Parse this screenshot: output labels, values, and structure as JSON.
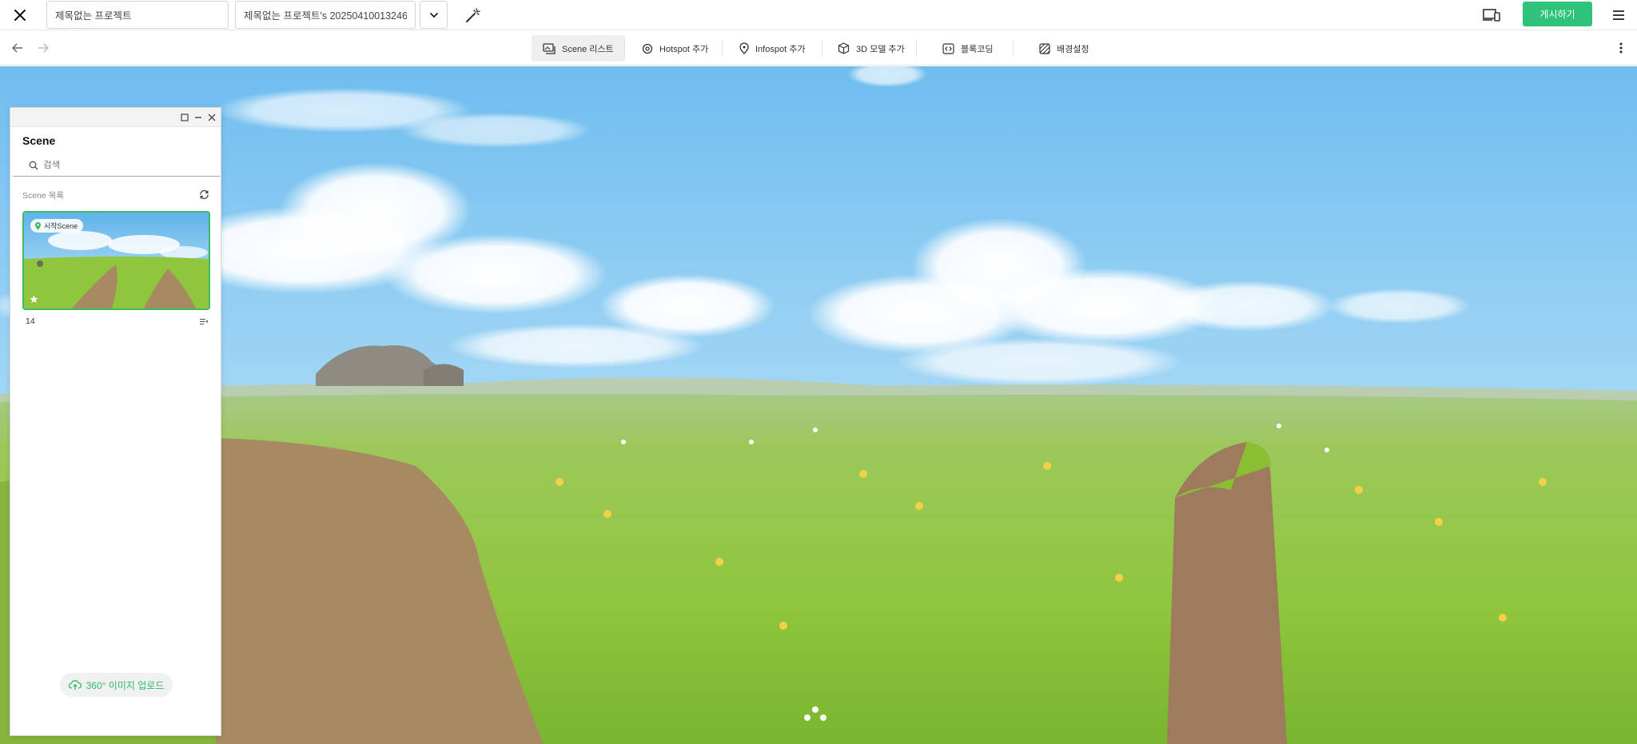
{
  "topbar": {
    "project_title": "제목없는 프로젝트",
    "version_name": "제목없는 프로젝트's 20250410013246",
    "publish_label": "게시하기"
  },
  "toolbar": {
    "tools": [
      {
        "label": "Scene 리스트",
        "icon": "scene-list-icon",
        "active": true
      },
      {
        "label": "Hotspot 추가",
        "icon": "hotspot-icon",
        "active": false
      },
      {
        "label": "Infospot 추가",
        "icon": "infospot-icon",
        "active": false
      },
      {
        "label": "3D 모델 추가",
        "icon": "cube-icon",
        "active": false
      },
      {
        "label": "블록코딩",
        "icon": "code-block-icon",
        "active": false
      },
      {
        "label": "배경설정",
        "icon": "background-pattern-icon",
        "active": false
      }
    ]
  },
  "scene_panel": {
    "title": "Scene",
    "search_placeholder": "검색",
    "list_label": "Scene 목록",
    "scenes": [
      {
        "badge": "시작Scene",
        "name": "14"
      }
    ],
    "upload_label": "360° 이미지 업로드"
  },
  "colors": {
    "accent": "#2fc27a",
    "selected_border": "#3dbb63",
    "sky_top": "#7cc4f0",
    "grass": "#8fc63d"
  }
}
